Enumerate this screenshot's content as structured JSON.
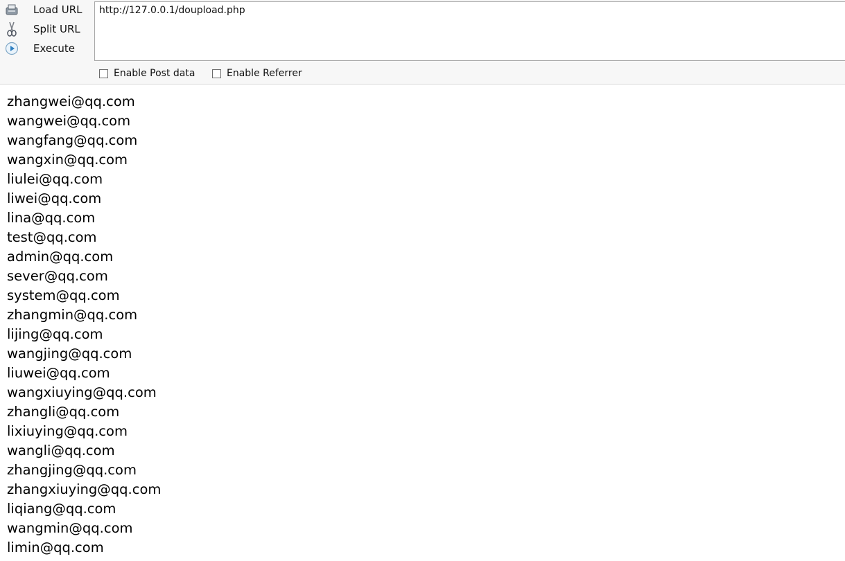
{
  "toolbar": {
    "load_url_label": "Load URL",
    "split_url_label": "Split URL",
    "execute_label": "Execute",
    "url_value": "http://127.0.0.1/doupload.php",
    "enable_post_label": "Enable Post data",
    "enable_referrer_label": "Enable Referrer",
    "enable_post_checked": false,
    "enable_referrer_checked": false
  },
  "emails": [
    "zhangwei@qq.com",
    "wangwei@qq.com",
    "wangfang@qq.com",
    "wangxin@qq.com",
    "liulei@qq.com",
    "liwei@qq.com",
    "lina@qq.com",
    "test@qq.com",
    "admin@qq.com",
    "sever@qq.com",
    "system@qq.com",
    "zhangmin@qq.com",
    "lijing@qq.com",
    "wangjing@qq.com",
    "liuwei@qq.com",
    "wangxiuying@qq.com",
    "zhangli@qq.com",
    "lixiuying@qq.com",
    "wangli@qq.com",
    "zhangjing@qq.com",
    "zhangxiuying@qq.com",
    "liqiang@qq.com",
    "wangmin@qq.com",
    "limin@qq.com"
  ]
}
